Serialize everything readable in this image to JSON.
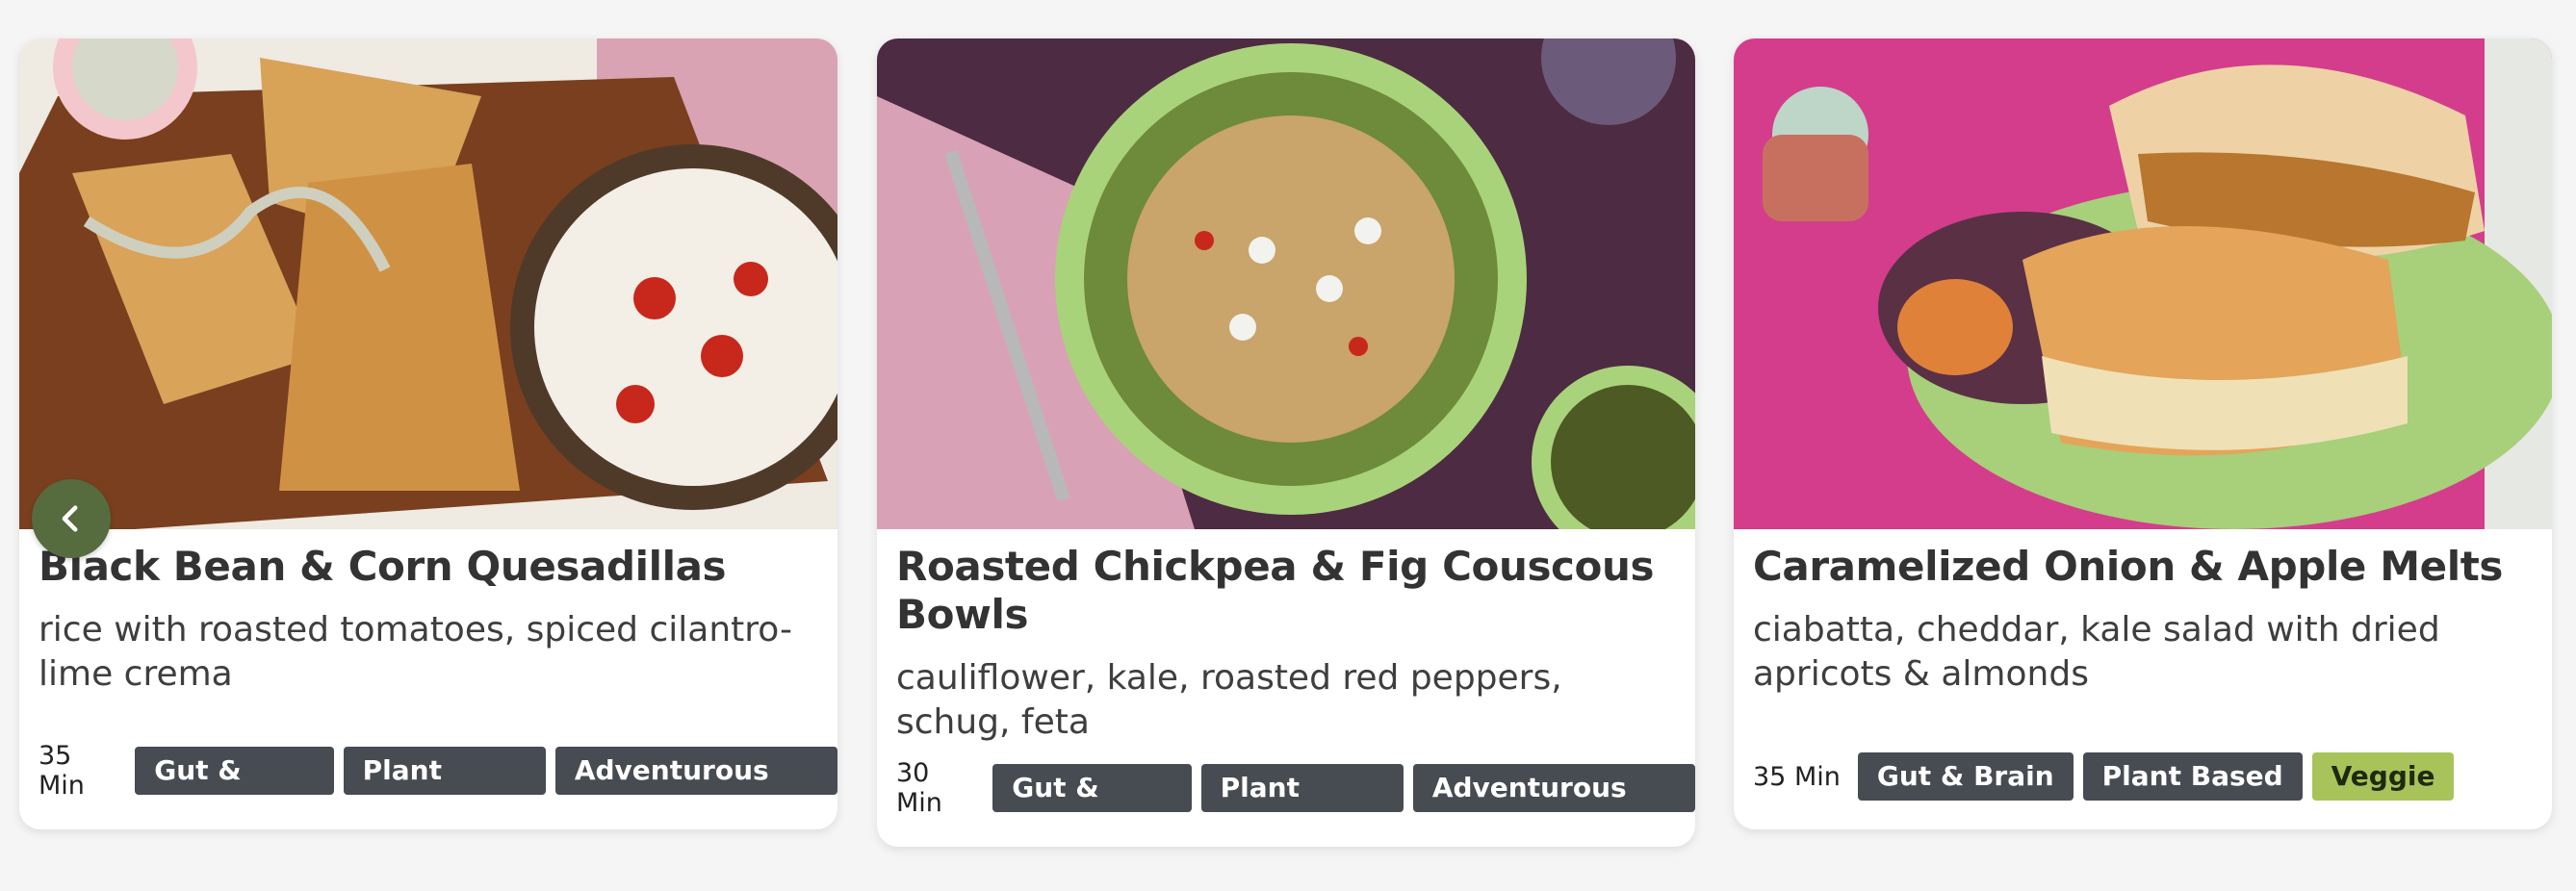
{
  "recipes": [
    {
      "title": "Black Bean & Corn Quesadillas",
      "description": "rice with roasted tomatoes, spiced cilantro-lime crema",
      "time": "35 Min",
      "tags": [
        "Gut & Brain",
        "Plant Based",
        "Adventurous Eats"
      ]
    },
    {
      "title": "Roasted Chickpea & Fig Couscous Bowls",
      "description": "cauliflower, kale, roasted red peppers, schug, feta",
      "time": "30 Min",
      "tags": [
        "Gut & Brain",
        "Plant Based",
        "Adventurous Eats"
      ]
    },
    {
      "title": "Caramelized Onion & Apple Melts",
      "description": "ciabatta, cheddar, kale salad with dried apricots & almonds",
      "time": "35 Min",
      "tags": [
        "Gut & Brain",
        "Plant Based",
        "Veggie"
      ]
    }
  ],
  "carousel": {
    "prev_icon": "chevron-left-icon",
    "prev_color": "#566b3e"
  },
  "colors": {
    "tag_dark": "#474b52",
    "tag_veggie": "#a8c35a"
  }
}
